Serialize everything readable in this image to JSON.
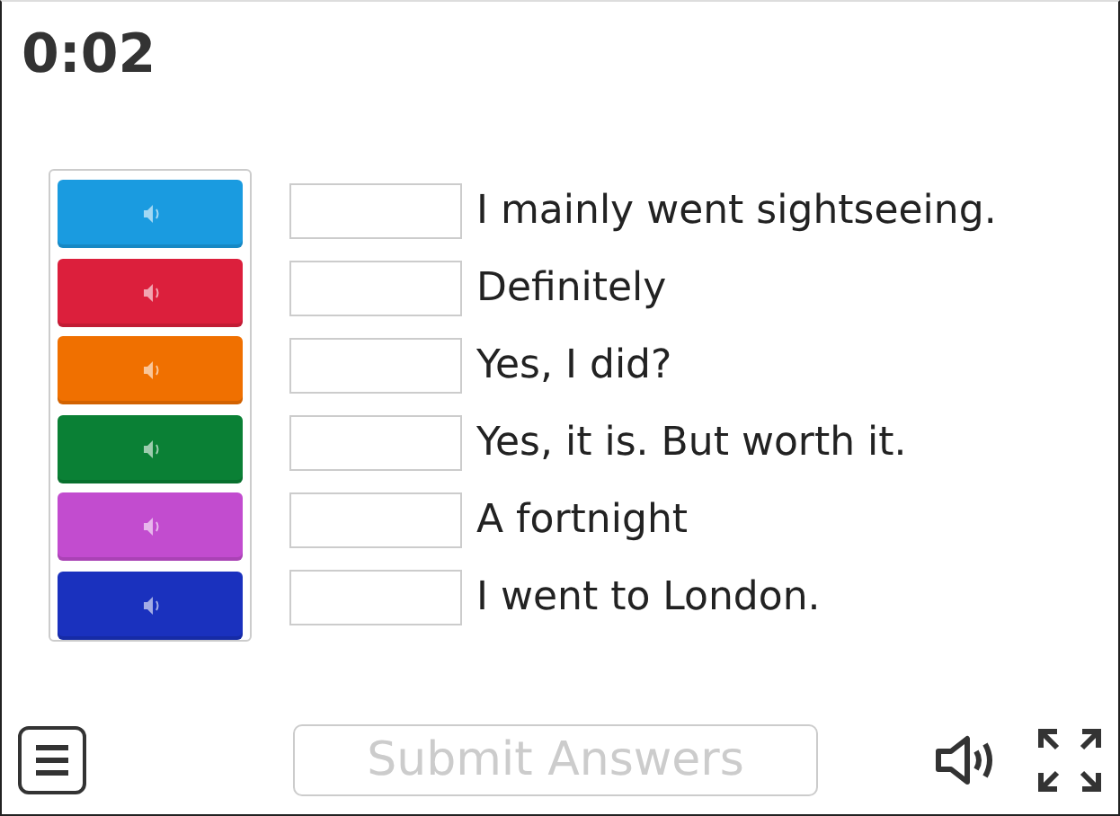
{
  "timer": "0:02",
  "audio_tiles": [
    {
      "color": "#1a9be0"
    },
    {
      "color": "#dc1f3c"
    },
    {
      "color": "#f07000"
    },
    {
      "color": "#0a8035"
    },
    {
      "color": "#c24ccf"
    },
    {
      "color": "#1a31be"
    }
  ],
  "answers": [
    {
      "text": "I mainly went sightseeing."
    },
    {
      "text": "Definitely"
    },
    {
      "text": "Yes, I did?"
    },
    {
      "text": "Yes, it is. But worth it."
    },
    {
      "text": "A fortnight"
    },
    {
      "text": "I went to London."
    }
  ],
  "submit_button": {
    "label": "Submit Answers",
    "disabled": true
  }
}
